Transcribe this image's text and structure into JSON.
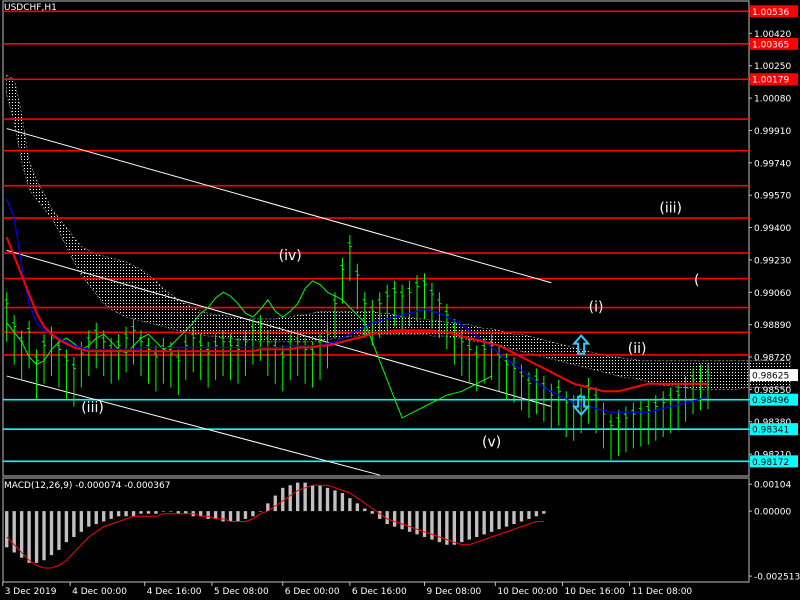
{
  "header": {
    "symbol_title": "USDCHF,H1"
  },
  "indicator": {
    "macd_title": "MACD(12,26,9) -0.000074 -0.000367"
  },
  "colors": {
    "background": "#000000",
    "candle": "#00ff00",
    "sma_fast": "#0000ff",
    "sma_slow": "#ff0000",
    "channel": "#ffffff",
    "level_red": "#ff0000",
    "level_cyan": "#00ffff",
    "cloud": "#ffffff",
    "arrow": "#33ccff",
    "macd_signal": "#ff0000"
  },
  "chart_data": [
    {
      "type": "line",
      "title": "USDCHF,H1",
      "ylim": [
        0.98095,
        1.0059
      ],
      "y_ticks": [
        "1.00536",
        "1.00420",
        "1.00365",
        "1.00250",
        "1.00179",
        "1.00080",
        "0.99910",
        "0.99740",
        "0.99570",
        "0.99400",
        "0.99230",
        "0.99060",
        "0.98890",
        "0.98720",
        "0.98625",
        "0.98550",
        "0.98496",
        "0.98380",
        "0.98341",
        "0.98210",
        "0.98172"
      ],
      "x_ticks": [
        "3 Dec 2019",
        "4 Dec 00:00",
        "4 Dec 16:00",
        "5 Dec 08:00",
        "6 Dec 00:00",
        "6 Dec 16:00",
        "9 Dec 08:00",
        "10 Dec 00:00",
        "10 Dec 16:00",
        "11 Dec 08:00"
      ],
      "horizontal_levels": [
        {
          "label": "1.00536",
          "value": 1.00536,
          "color": "red"
        },
        {
          "label": "1.00365",
          "value": 1.00365,
          "color": "red"
        },
        {
          "label": "1.00179",
          "value": 1.00179,
          "color": "red"
        },
        {
          "label": "0.99970",
          "value": 0.9997,
          "color": "red"
        },
        {
          "label": "0.99804",
          "value": 0.99804,
          "color": "red"
        },
        {
          "label": "0.99620",
          "value": 0.9962,
          "color": "red"
        },
        {
          "label": "0.99450",
          "value": 0.9945,
          "color": "red"
        },
        {
          "label": "0.99266",
          "value": 0.99266,
          "color": "red"
        },
        {
          "label": "0.99132",
          "value": 0.99132,
          "color": "red"
        },
        {
          "label": "0.98980",
          "value": 0.9898,
          "color": "red"
        },
        {
          "label": "0.98850",
          "value": 0.9885,
          "color": "red"
        },
        {
          "label": "0.98731",
          "value": 0.98731,
          "color": "red"
        },
        {
          "label": "0.98496",
          "value": 0.98496,
          "color": "cyan"
        },
        {
          "label": "0.98341",
          "value": 0.98341,
          "color": "cyan"
        },
        {
          "label": "0.98172",
          "value": 0.98172,
          "color": "cyan"
        }
      ],
      "current_price": {
        "label": "0.98625",
        "value": 0.98625
      },
      "price_close": [
        0.99,
        0.9888,
        0.988,
        0.9885,
        0.987,
        0.9878,
        0.9882,
        0.9876,
        0.987,
        0.9866,
        0.9874,
        0.988,
        0.9884,
        0.988,
        0.9876,
        0.9878,
        0.9882,
        0.9886,
        0.988,
        0.9876,
        0.9872,
        0.9876,
        0.9874,
        0.987,
        0.9878,
        0.9882,
        0.9878,
        0.9874,
        0.9878,
        0.988,
        0.9878,
        0.9876,
        0.988,
        0.9886,
        0.9888,
        0.988,
        0.9876,
        0.9872,
        0.9878,
        0.988,
        0.9876,
        0.9874,
        0.9878,
        0.9884,
        0.99,
        0.9918,
        0.993,
        0.9915,
        0.99,
        0.9896,
        0.99,
        0.9904,
        0.9906,
        0.9904,
        0.9906,
        0.9909,
        0.991,
        0.9905,
        0.99,
        0.9894,
        0.9886,
        0.988,
        0.9876,
        0.9872,
        0.9876,
        0.9878,
        0.9872,
        0.9868,
        0.9866,
        0.9862,
        0.9858,
        0.986,
        0.9856,
        0.9852,
        0.9854,
        0.9848,
        0.9846,
        0.985,
        0.9855,
        0.985,
        0.9842,
        0.9836,
        0.9838,
        0.984,
        0.9842,
        0.9843,
        0.9844,
        0.9846,
        0.9848,
        0.985,
        0.9852,
        0.9856,
        0.986,
        0.9862,
        0.98625
      ],
      "price_low": [
        0.988,
        0.9868,
        0.986,
        0.9866,
        0.985,
        0.9858,
        0.9862,
        0.9856,
        0.985,
        0.9846,
        0.9856,
        0.9862,
        0.9866,
        0.9862,
        0.9858,
        0.986,
        0.9864,
        0.9868,
        0.9862,
        0.9858,
        0.9854,
        0.9858,
        0.9856,
        0.9852,
        0.986,
        0.9864,
        0.986,
        0.9856,
        0.986,
        0.9862,
        0.986,
        0.9858,
        0.9862,
        0.9868,
        0.987,
        0.9862,
        0.9858,
        0.9854,
        0.986,
        0.9862,
        0.9858,
        0.9856,
        0.986,
        0.9866,
        0.9882,
        0.99,
        0.9912,
        0.9897,
        0.9882,
        0.9878,
        0.9882,
        0.9886,
        0.9888,
        0.9886,
        0.9888,
        0.9891,
        0.9892,
        0.9887,
        0.9882,
        0.9876,
        0.9868,
        0.9862,
        0.9858,
        0.9854,
        0.9858,
        0.986,
        0.9854,
        0.985,
        0.9848,
        0.9844,
        0.984,
        0.9842,
        0.9838,
        0.9834,
        0.9836,
        0.983,
        0.9828,
        0.9832,
        0.9837,
        0.9832,
        0.9824,
        0.9818,
        0.982,
        0.9822,
        0.9824,
        0.9825,
        0.9826,
        0.9828,
        0.983,
        0.9832,
        0.9834,
        0.9838,
        0.9842,
        0.9844,
        0.98446
      ],
      "sma_fast": [
        0.9955,
        0.9945,
        0.992,
        0.99,
        0.989,
        0.9886,
        0.9884,
        0.9882,
        0.988,
        0.9878,
        0.9877,
        0.9876,
        0.9876,
        0.9876,
        0.9876,
        0.9876,
        0.9876,
        0.9876,
        0.9877,
        0.9877,
        0.9877,
        0.9877,
        0.9877,
        0.9877,
        0.9877,
        0.9877,
        0.9877,
        0.9877,
        0.9877,
        0.9877,
        0.9877,
        0.9877,
        0.9877,
        0.9877,
        0.9877,
        0.9877,
        0.9877,
        0.9877,
        0.9878,
        0.9878,
        0.9878,
        0.9878,
        0.9878,
        0.9879,
        0.988,
        0.9882,
        0.9884,
        0.9886,
        0.9888,
        0.989,
        0.9891,
        0.9892,
        0.9893,
        0.9894,
        0.9895,
        0.9896,
        0.9897,
        0.9896,
        0.9895,
        0.9893,
        0.9891,
        0.9889,
        0.9886,
        0.9883,
        0.988,
        0.9877,
        0.9874,
        0.9871,
        0.9868,
        0.9865,
        0.9862,
        0.9859,
        0.9856,
        0.9854,
        0.9852,
        0.985,
        0.9848,
        0.9847,
        0.9846,
        0.9845,
        0.9844,
        0.9843,
        0.9843,
        0.9843,
        0.9843,
        0.9843,
        0.9843,
        0.9844,
        0.9845,
        0.9846,
        0.9847,
        0.9848,
        0.9849,
        0.985,
        0.9851
      ],
      "sma_slow": [
        0.9935,
        0.9925,
        0.9915,
        0.9905,
        0.9895,
        0.9888,
        0.9884,
        0.9881,
        0.9879,
        0.9877,
        0.9876,
        0.9875,
        0.9875,
        0.9875,
        0.9875,
        0.9875,
        0.9875,
        0.9875,
        0.9875,
        0.9875,
        0.9875,
        0.9875,
        0.9875,
        0.9875,
        0.9875,
        0.9875,
        0.9875,
        0.9875,
        0.9875,
        0.9875,
        0.9875,
        0.9875,
        0.9875,
        0.9875,
        0.9876,
        0.9876,
        0.9876,
        0.9876,
        0.9876,
        0.9877,
        0.9877,
        0.9877,
        0.9878,
        0.9878,
        0.9879,
        0.988,
        0.9881,
        0.9882,
        0.9883,
        0.9884,
        0.9885,
        0.9885,
        0.9886,
        0.9886,
        0.9886,
        0.9886,
        0.9886,
        0.9886,
        0.9885,
        0.9885,
        0.9884,
        0.9883,
        0.9882,
        0.9881,
        0.988,
        0.9879,
        0.9878,
        0.9876,
        0.9874,
        0.9872,
        0.987,
        0.9868,
        0.9866,
        0.9864,
        0.9862,
        0.986,
        0.9858,
        0.9857,
        0.9856,
        0.9855,
        0.9854,
        0.9854,
        0.9854,
        0.9855,
        0.9856,
        0.9857,
        0.9858,
        0.9858,
        0.9858,
        0.9858,
        0.9858,
        0.9858,
        0.9858,
        0.9858,
        0.9858
      ],
      "cloud_upper": [
        1.002,
        1.0018,
        1.0,
        0.9975,
        0.9965,
        0.9958,
        0.995,
        0.9945,
        0.994,
        0.9935,
        0.993,
        0.9928,
        0.9926,
        0.9925,
        0.9924,
        0.9923,
        0.9922,
        0.992,
        0.9918,
        0.9915,
        0.9912,
        0.9908,
        0.9905,
        0.9902,
        0.99,
        0.9898,
        0.9896,
        0.9895,
        0.9894,
        0.9894,
        0.9893,
        0.9893,
        0.9892,
        0.9892,
        0.9892,
        0.9892,
        0.9892,
        0.9893,
        0.9893,
        0.9894,
        0.9894,
        0.9895,
        0.9896,
        0.9896,
        0.9896,
        0.9896,
        0.9896,
        0.9896,
        0.9896,
        0.9896,
        0.9895,
        0.9895,
        0.9894,
        0.9893,
        0.9893,
        0.9892,
        0.9892,
        0.9891,
        0.9891,
        0.989,
        0.989,
        0.9889,
        0.9889,
        0.9888,
        0.9887,
        0.9887,
        0.9886,
        0.9885,
        0.9884,
        0.9884,
        0.9883,
        0.9882,
        0.9881,
        0.988,
        0.9879,
        0.9878,
        0.9877,
        0.9876,
        0.9875,
        0.9874,
        0.9873,
        0.9872,
        0.9872,
        0.9871,
        0.9871,
        0.987,
        0.987,
        0.987,
        0.987,
        0.987,
        0.987,
        0.987,
        0.987,
        0.987,
        0.987,
        0.987,
        0.987,
        0.987,
        0.987,
        0.987,
        0.987,
        0.987,
        0.987,
        0.987,
        0.987,
        0.987
      ],
      "cloud_lower": [
        1.001,
        0.9995,
        0.9975,
        0.996,
        0.9955,
        0.995,
        0.9945,
        0.9938,
        0.993,
        0.9922,
        0.9915,
        0.991,
        0.9905,
        0.99,
        0.9897,
        0.9895,
        0.9893,
        0.9892,
        0.9891,
        0.989,
        0.9889,
        0.9888,
        0.9887,
        0.9886,
        0.9885,
        0.9884,
        0.9884,
        0.9883,
        0.9883,
        0.9882,
        0.9882,
        0.9881,
        0.9881,
        0.9881,
        0.988,
        0.988,
        0.988,
        0.988,
        0.988,
        0.988,
        0.988,
        0.988,
        0.9881,
        0.9881,
        0.9882,
        0.9882,
        0.9883,
        0.9883,
        0.9884,
        0.9884,
        0.9884,
        0.9884,
        0.9884,
        0.9884,
        0.9884,
        0.9884,
        0.9884,
        0.9883,
        0.9883,
        0.9883,
        0.9882,
        0.9882,
        0.9881,
        0.988,
        0.988,
        0.9879,
        0.9878,
        0.9877,
        0.9876,
        0.9875,
        0.9874,
        0.9873,
        0.9872,
        0.9871,
        0.987,
        0.9869,
        0.9868,
        0.9867,
        0.9866,
        0.9865,
        0.9864,
        0.9863,
        0.9862,
        0.9861,
        0.9861,
        0.986,
        0.9859,
        0.9858,
        0.9857,
        0.9857,
        0.9856,
        0.9856,
        0.9855,
        0.9855,
        0.9855,
        0.9855,
        0.9855,
        0.9855,
        0.9855,
        0.9856,
        0.9856,
        0.9856,
        0.9856,
        0.9856,
        0.9856,
        0.9856
      ],
      "lagging_line": [
        0.989,
        0.9885,
        0.988,
        0.9872,
        0.9868,
        0.987,
        0.9876,
        0.988,
        0.9882,
        0.9879,
        0.9876,
        0.9878,
        0.9882,
        0.9884,
        0.988,
        0.9876,
        0.9874,
        0.9878,
        0.9882,
        0.9884,
        0.988,
        0.9876,
        0.9878,
        0.9882,
        0.9886,
        0.989,
        0.9895,
        0.9898,
        0.9903,
        0.9906,
        0.9904,
        0.99,
        0.9895,
        0.9893,
        0.9897,
        0.9902,
        0.9896,
        0.9893,
        0.9896,
        0.99,
        0.9908,
        0.9912,
        0.991,
        0.9906,
        0.9904,
        0.9902,
        0.9898,
        0.9894,
        0.989,
        0.988,
        0.987,
        0.986,
        0.985,
        0.984,
        0.9842,
        0.9844,
        0.9846,
        0.9848,
        0.985,
        0.9852,
        0.9853,
        0.9854,
        0.9856,
        0.9858,
        0.986,
        0.9862
      ],
      "channel_lines": [
        {
          "x_start": 0.0,
          "y_start": 0.9992,
          "x_end": 73.0,
          "y_end": 0.9911
        },
        {
          "x_start": 0.0,
          "y_start": 0.9928,
          "x_end": 73.0,
          "y_end": 0.9846
        },
        {
          "x_start": 0.0,
          "y_start": 0.9862,
          "x_end": 50.0,
          "y_end": 0.981
        }
      ],
      "wave_labels": [
        {
          "text": "(iii)",
          "x": 11.5,
          "y": 0.9843
        },
        {
          "text": "(iv)",
          "x": 38.0,
          "y": 0.9923
        },
        {
          "text": "(v)",
          "x": 65.0,
          "y": 0.9825
        },
        {
          "text": "(i)",
          "x": 79.0,
          "y": 0.9896
        },
        {
          "text": "(ii)",
          "x": 84.5,
          "y": 0.9874
        },
        {
          "text": "(iii)",
          "x": 89.0,
          "y": 0.9948
        },
        {
          "text": "(",
          "x": 92.5,
          "y": 0.991
        }
      ],
      "arrows": [
        {
          "direction": "up",
          "x": 77.0,
          "y": 0.9878
        },
        {
          "direction": "down",
          "x": 77.0,
          "y": 0.9847
        }
      ]
    },
    {
      "type": "bar",
      "title": "MACD(12,26,9) -0.000074 -0.000367",
      "ylim": [
        -0.00274,
        0.00128
      ],
      "y_ticks": [
        "0.00104",
        "0.00000",
        "-0.002513"
      ],
      "histogram": [
        -0.0014,
        -0.0016,
        -0.0018,
        -0.002,
        -0.002,
        -0.0019,
        -0.0017,
        -0.0015,
        -0.0012,
        -0.001,
        -0.0008,
        -0.0006,
        -0.0005,
        -0.0004,
        -0.0003,
        -0.0002,
        -0.0002,
        -0.0002,
        -0.0001,
        -0.0001,
        -0.0001,
        0.0,
        0.0,
        -0.0001,
        -0.0001,
        -0.0002,
        -0.0002,
        -0.0003,
        -0.0003,
        -0.0004,
        -0.0004,
        -0.0004,
        -0.0003,
        -0.0002,
        0.0,
        0.0003,
        0.0006,
        0.0009,
        0.001,
        0.0011,
        0.0011,
        0.001,
        0.001,
        0.0009,
        0.0008,
        0.0007,
        0.0005,
        0.0003,
        0.0001,
        -0.0001,
        -0.0003,
        -0.0005,
        -0.0006,
        -0.0007,
        -0.0008,
        -0.0009,
        -0.001,
        -0.0011,
        -0.0012,
        -0.0013,
        -0.0013,
        -0.0012,
        -0.0011,
        -0.001,
        -0.0009,
        -0.0008,
        -0.0007,
        -0.0006,
        -0.0005,
        -0.0004,
        -0.0003,
        -0.0002,
        -0.0001
      ],
      "signal": [
        -0.001,
        -0.0013,
        -0.0016,
        -0.0019,
        -0.0021,
        -0.0022,
        -0.0022,
        -0.0021,
        -0.0019,
        -0.0016,
        -0.0013,
        -0.001,
        -0.0008,
        -0.0006,
        -0.0005,
        -0.0004,
        -0.0003,
        -0.0002,
        -0.0002,
        -0.0002,
        -0.0002,
        -0.0001,
        -0.0001,
        -0.0001,
        -0.0001,
        -0.0001,
        -0.0002,
        -0.0002,
        -0.0003,
        -0.0003,
        -0.0004,
        -0.0004,
        -0.0004,
        -0.0003,
        -0.0001,
        0.0,
        0.0002,
        0.0004,
        0.0006,
        0.0008,
        0.0009,
        0.001,
        0.001,
        0.001,
        0.0009,
        0.0008,
        0.0007,
        0.0005,
        0.0003,
        0.0001,
        -0.0001,
        -0.0003,
        -0.0004,
        -0.0005,
        -0.0006,
        -0.0007,
        -0.0008,
        -0.0009,
        -0.001,
        -0.0011,
        -0.0012,
        -0.0013,
        -0.0013,
        -0.0012,
        -0.0011,
        -0.001,
        -0.0009,
        -0.0008,
        -0.0007,
        -0.0006,
        -0.0005,
        -0.0004,
        -0.0004
      ]
    }
  ]
}
